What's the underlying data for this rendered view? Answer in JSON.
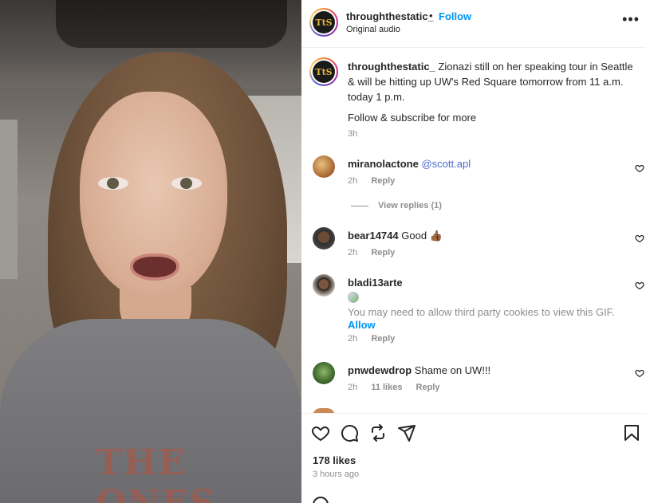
{
  "video": {
    "shirt_print": "THE ONES"
  },
  "header": {
    "username": "throughthestatic_",
    "separator": "•",
    "follow_label": "Follow",
    "subtitle": "Original audio",
    "more_label": "•••",
    "avatar_text": "TtS"
  },
  "caption": {
    "username": "throughthestatic_",
    "text": "Zionazi still on her speaking tour in Seattle & will be hitting up UW's Red Square tomorrow from 11 a.m. today 1 p.m.",
    "follow_line": "Follow & subscribe for more",
    "time": "3h"
  },
  "comments": [
    {
      "username": "miranolactone",
      "text": "@scott.apl",
      "time": "2h",
      "reply_label": "Reply",
      "view_replies": "View replies (1)"
    },
    {
      "username": "bear14744",
      "text": "Good 👍🏾",
      "time": "2h",
      "reply_label": "Reply"
    },
    {
      "username": "bladi13arte",
      "gif_note": "You may need to allow third party cookies to view this GIF.",
      "allow_label": "Allow",
      "time": "2h",
      "reply_label": "Reply"
    },
    {
      "username": "pnwdewdrop",
      "text": "Shame on UW!!!",
      "time": "2h",
      "likes": "11 likes",
      "reply_label": "Reply"
    }
  ],
  "footer": {
    "likes": "178 likes",
    "ago": "3 hours ago"
  },
  "colors": {
    "accent": "#0095f6",
    "text": "#262626",
    "muted": "#8e8e8e"
  },
  "icons": [
    "more-options-icon",
    "heart-icon",
    "comment-icon",
    "repost-icon",
    "share-icon",
    "bookmark-icon"
  ]
}
